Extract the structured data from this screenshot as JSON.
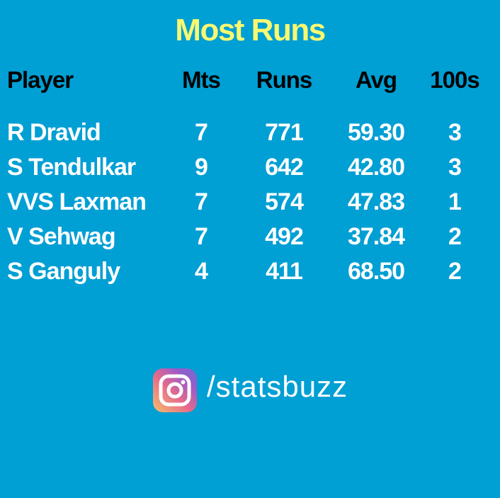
{
  "title": "Most Runs",
  "columns": [
    "Player",
    "Mts",
    "Runs",
    "Avg",
    "100s"
  ],
  "rows": [
    {
      "player": "R Dravid",
      "mts": "7",
      "runs": "771",
      "avg": "59.30",
      "hundreds": "3"
    },
    {
      "player": "S Tendulkar",
      "mts": "9",
      "runs": "642",
      "avg": "42.80",
      "hundreds": "3"
    },
    {
      "player": "VVS Laxman",
      "mts": "7",
      "runs": "574",
      "avg": "47.83",
      "hundreds": "1"
    },
    {
      "player": "V Sehwag",
      "mts": "7",
      "runs": "492",
      "avg": "37.84",
      "hundreds": "2"
    },
    {
      "player": "S Ganguly",
      "mts": "4",
      "runs": "411",
      "avg": "68.50",
      "hundreds": "2"
    }
  ],
  "footer": {
    "icon": "instagram-icon",
    "handle": "/statsbuzz"
  },
  "colors": {
    "background": "#009fd4",
    "title": "#f9f871",
    "header": "#000000",
    "cell": "#ffffff"
  }
}
